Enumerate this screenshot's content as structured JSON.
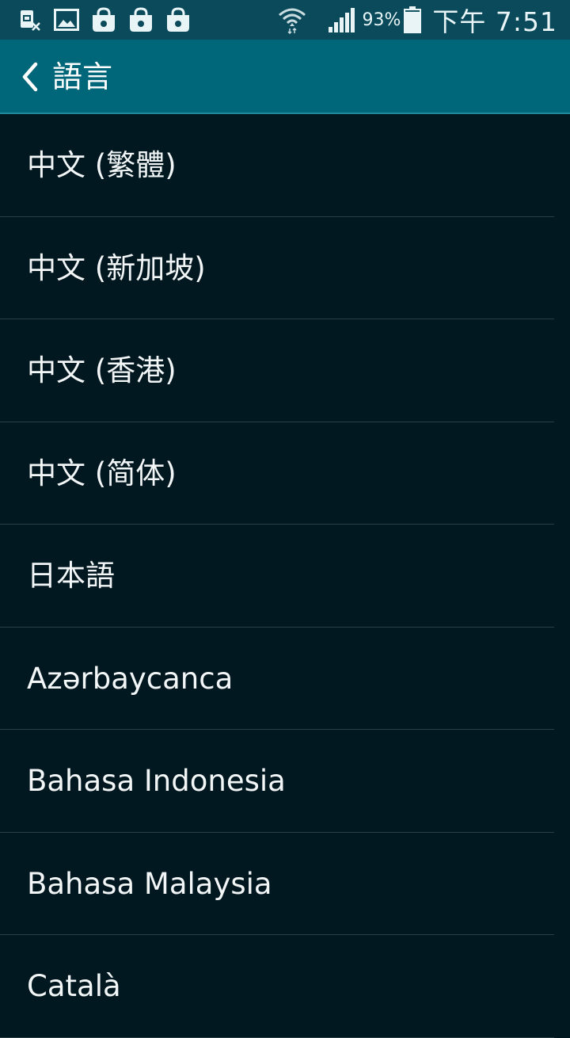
{
  "status_bar": {
    "notification_icons": [
      "sim-card-x-icon",
      "image-icon",
      "shopping-bag-icon",
      "shopping-bag-icon",
      "shopping-bag-icon"
    ],
    "wifi_icon": "wifi-icon",
    "signal_icon": "cellular-signal-icon",
    "battery_percent": "93%",
    "battery_level": 0.93,
    "time": "下午 7:51"
  },
  "app_bar": {
    "back_icon": "chevron-left-icon",
    "title": "語言"
  },
  "languages": [
    "中文 (繁體)",
    "中文 (新加坡)",
    "中文 (香港)",
    "中文 (简体)",
    "日本語",
    "Azərbaycanca",
    "Bahasa Indonesia",
    "Bahasa Malaysia",
    "Català"
  ],
  "colors": {
    "status_bar": "#0a4a5a",
    "app_bar": "#00677a",
    "background": "#021820",
    "divider": "#2a3e45",
    "text": "#f2f6f7"
  }
}
